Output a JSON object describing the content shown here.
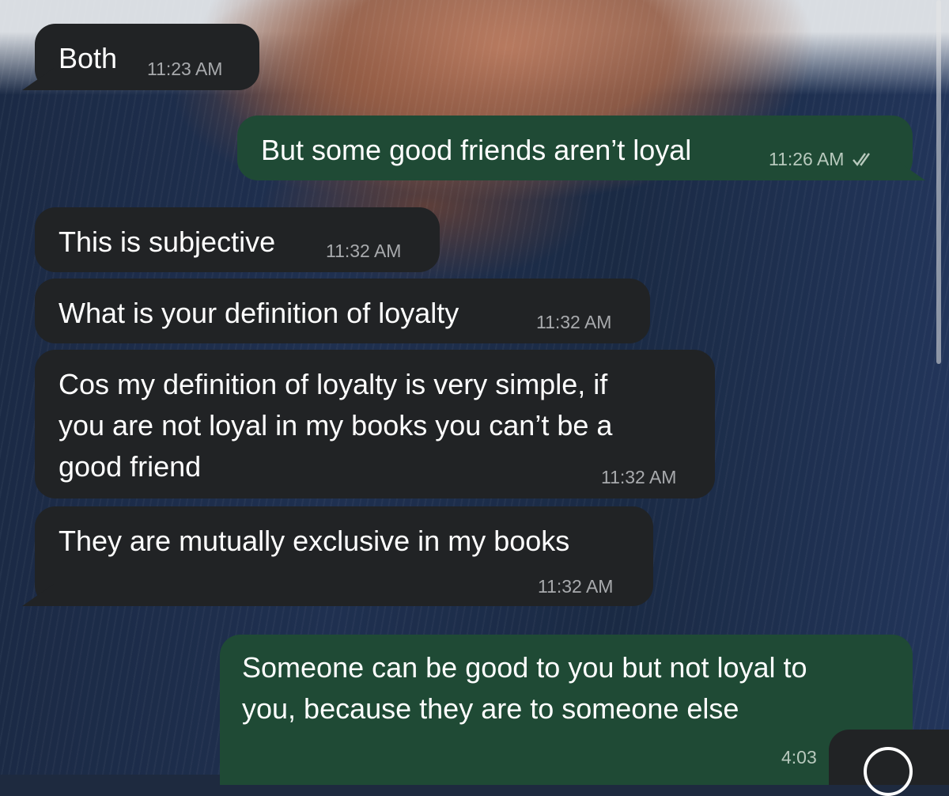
{
  "messages": [
    {
      "text": "Both",
      "time": "11:23 AM",
      "direction": "incoming"
    },
    {
      "text": "But some good friends aren’t loyal",
      "time": "11:26 AM",
      "direction": "outgoing",
      "status_icon": "double-check-icon"
    },
    {
      "text": "This is subjective",
      "time": "11:32 AM",
      "direction": "incoming"
    },
    {
      "text": "What is your definition of loyalty",
      "time": "11:32 AM",
      "direction": "incoming"
    },
    {
      "lines": [
        "Cos my definition of loyalty is very simple, if",
        "you are not loyal in my books you can’t be a",
        "good friend"
      ],
      "time": "11:32 AM",
      "direction": "incoming"
    },
    {
      "text": "They are mutually exclusive in my books",
      "time": "11:32 AM",
      "direction": "incoming"
    },
    {
      "lines": [
        "Someone can be good to you but not loyal to",
        "you, because they are to someone else"
      ],
      "time": "4:03",
      "direction": "outgoing"
    }
  ],
  "colors": {
    "incoming_bubble": "#212325",
    "outgoing_bubble": "#1f4a35",
    "timestamp": "#a8aaad"
  },
  "controls": {
    "scroll_button_icon": "scroll-down-icon"
  }
}
